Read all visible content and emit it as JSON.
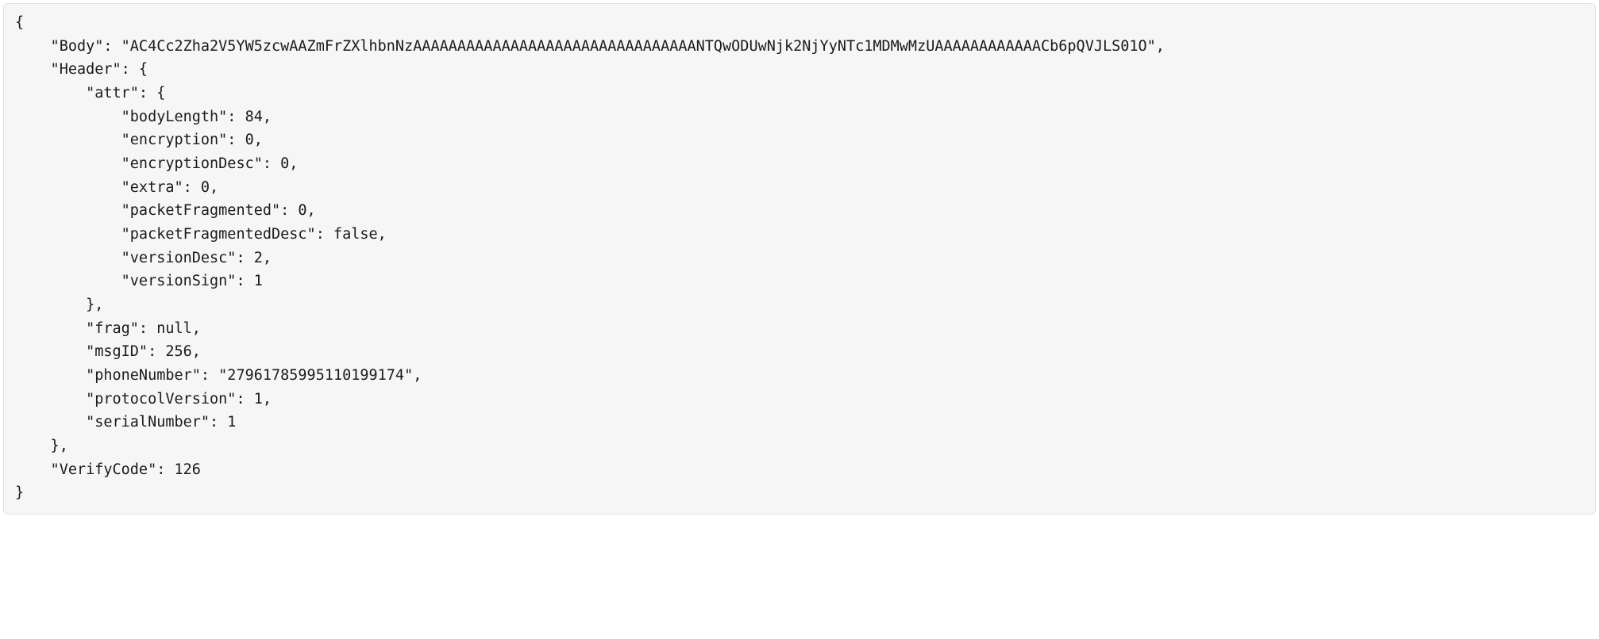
{
  "code": {
    "lines": [
      "{",
      "    \"Body\": \"AC4Cc2Zha2V5YW5zcwAAZmFrZXlhbnNzAAAAAAAAAAAAAAAAAAAAAAAAAAAAAAAANTQwODUwNjk2NjYyNTc1MDMwMzUAAAAAAAAAAAACb6pQVJLS01O\",",
      "    \"Header\": {",
      "        \"attr\": {",
      "            \"bodyLength\": 84,",
      "            \"encryption\": 0,",
      "            \"encryptionDesc\": 0,",
      "            \"extra\": 0,",
      "            \"packetFragmented\": 0,",
      "            \"packetFragmentedDesc\": false,",
      "            \"versionDesc\": 2,",
      "            \"versionSign\": 1",
      "        },",
      "        \"frag\": null,",
      "        \"msgID\": 256,",
      "        \"phoneNumber\": \"27961785995110199174\",",
      "        \"protocolVersion\": 1,",
      "        \"serialNumber\": 1",
      "    },",
      "    \"VerifyCode\": 126",
      "}"
    ]
  },
  "parsed_json": {
    "Body": "AC4Cc2Zha2V5YW5zcwAAZmFrZXlhbnNzAAAAAAAAAAAAAAAAAAAAAAAAAAAAAAAANTQwODUwNjk2NjYyNTc1MDMwMzUAAAAAAAAAAAACb6pQVJLS01O",
    "Header": {
      "attr": {
        "bodyLength": 84,
        "encryption": 0,
        "encryptionDesc": 0,
        "extra": 0,
        "packetFragmented": 0,
        "packetFragmentedDesc": false,
        "versionDesc": 2,
        "versionSign": 1
      },
      "frag": null,
      "msgID": 256,
      "phoneNumber": "27961785995110199174",
      "protocolVersion": 1,
      "serialNumber": 1
    },
    "VerifyCode": 126
  }
}
